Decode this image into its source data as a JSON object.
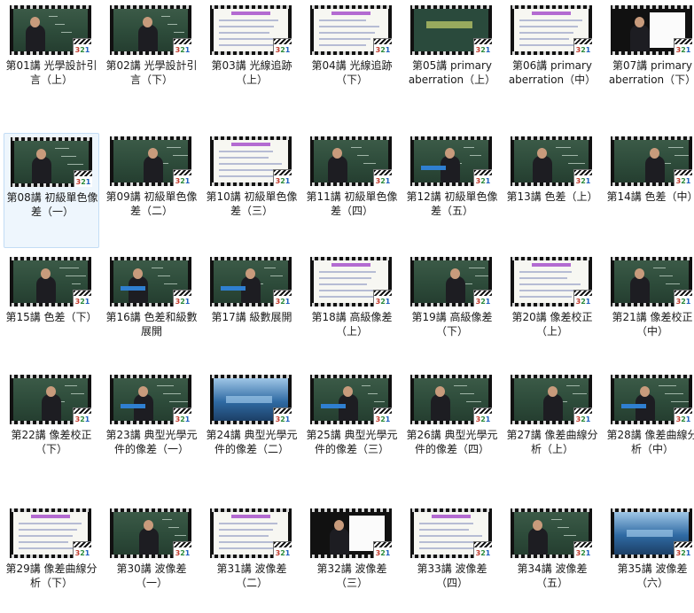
{
  "items": [
    {
      "label": "第01講 光學設計引言（上）",
      "kind": "board",
      "badge": "321",
      "selected": false
    },
    {
      "label": "第02講 光學設計引言（下）",
      "kind": "board",
      "badge": "321",
      "selected": false
    },
    {
      "label": "第03講 光線追跡（上）",
      "kind": "slide",
      "badge": "321",
      "selected": false
    },
    {
      "label": "第04講 光線追跡（下）",
      "kind": "slide",
      "badge": "321",
      "selected": false
    },
    {
      "label": "第05講 primary aberration（上）",
      "kind": "ppt",
      "badge": "321",
      "selected": false
    },
    {
      "label": "第06講 primary aberration（中）",
      "kind": "slide",
      "badge": "321",
      "selected": false
    },
    {
      "label": "第07講 primary aberration（下）",
      "kind": "whiteboard",
      "badge": "321",
      "selected": false
    },
    {
      "label": "第08講 初級單色像差（一）",
      "kind": "board",
      "badge": "321",
      "selected": true
    },
    {
      "label": "第09講 初級單色像差（二）",
      "kind": "board",
      "badge": "321",
      "selected": false
    },
    {
      "label": "第10講 初級單色像差（三）",
      "kind": "slide",
      "badge": "321",
      "selected": false
    },
    {
      "label": "第11講 初級單色像差（四）",
      "kind": "board",
      "badge": "321",
      "selected": false
    },
    {
      "label": "第12講 初級單色像差（五）",
      "kind": "boardbar",
      "badge": "321",
      "selected": false
    },
    {
      "label": "第13講 色差（上）",
      "kind": "board",
      "badge": "321",
      "selected": false
    },
    {
      "label": "第14講 色差（中）",
      "kind": "board",
      "badge": "321",
      "selected": false
    },
    {
      "label": "第15講 色差（下）",
      "kind": "board",
      "badge": "321",
      "selected": false
    },
    {
      "label": "第16講 色差和級數展開",
      "kind": "boardbar",
      "badge": "321",
      "selected": false
    },
    {
      "label": "第17講 級數展開",
      "kind": "boardbar",
      "badge": "321",
      "selected": false
    },
    {
      "label": "第18講 高級像差（上）",
      "kind": "slide",
      "badge": "321",
      "selected": false
    },
    {
      "label": "第19講 高級像差（下）",
      "kind": "board",
      "badge": "321",
      "selected": false
    },
    {
      "label": "第20講 像差校正（上）",
      "kind": "slide",
      "badge": "321",
      "selected": false
    },
    {
      "label": "第21講 像差校正（中）",
      "kind": "board",
      "badge": "321",
      "selected": false
    },
    {
      "label": "第22講 像差校正（下）",
      "kind": "board",
      "badge": "321",
      "selected": false
    },
    {
      "label": "第23講 典型光學元件的像差（一）",
      "kind": "boardbar",
      "badge": "321",
      "selected": false
    },
    {
      "label": "第24講 典型光學元件的像差（二）",
      "kind": "blue",
      "badge": "321",
      "selected": false
    },
    {
      "label": "第25講 典型光學元件的像差（三）",
      "kind": "boardbar",
      "badge": "321",
      "selected": false
    },
    {
      "label": "第26講 典型光學元件的像差（四）",
      "kind": "board",
      "badge": "321",
      "selected": false
    },
    {
      "label": "第27講 像差曲線分析（上）",
      "kind": "board",
      "badge": "321",
      "selected": false
    },
    {
      "label": "第28講 像差曲線分析（中）",
      "kind": "boardbar",
      "badge": "321",
      "selected": false
    },
    {
      "label": "第29講 像差曲線分析（下）",
      "kind": "slide",
      "badge": "321",
      "selected": false
    },
    {
      "label": "第30講 波像差（一）",
      "kind": "board",
      "badge": "321",
      "selected": false
    },
    {
      "label": "第31講 波像差（二）",
      "kind": "slide",
      "badge": "321",
      "selected": false
    },
    {
      "label": "第32講 波像差（三）",
      "kind": "whiteboard",
      "badge": "321",
      "selected": false
    },
    {
      "label": "第33講 波像差（四）",
      "kind": "slide",
      "badge": "321",
      "selected": false
    },
    {
      "label": "第34講 波像差（五）",
      "kind": "board",
      "badge": "321",
      "selected": false
    },
    {
      "label": "第35講 波像差（六）",
      "kind": "blue",
      "badge": "321",
      "selected": false
    }
  ]
}
